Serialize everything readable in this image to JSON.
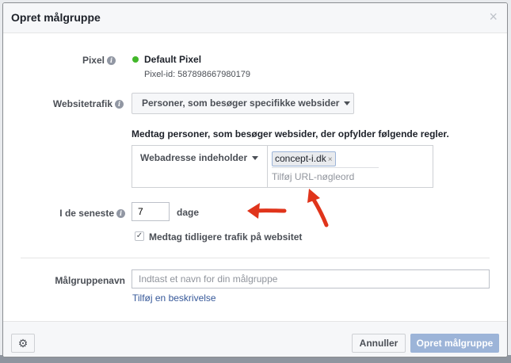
{
  "dialog": {
    "title": "Opret målgruppe",
    "close_glyph": "×"
  },
  "pixel": {
    "label": "Pixel",
    "name": "Default Pixel",
    "id_text": "Pixel-id: 587898667980179",
    "status_color": "#42b72a"
  },
  "traffic": {
    "label": "Websitetrafik",
    "selected": "Personer, som besøger specifikke websider"
  },
  "rules": {
    "title": "Medtag personer, som besøger websider, der opfylder følgende regler.",
    "condition": "Webadresse indeholder",
    "keyword_token": "concept-i.dk",
    "keyword_placeholder": "Tilføj URL-nøgleord"
  },
  "period": {
    "label": "I de seneste",
    "value": "7",
    "unit": "dage",
    "checkbox_checked": true,
    "checkbox_label": "Medtag tidligere trafik på websitet"
  },
  "audience_name": {
    "label": "Målgruppenavn",
    "placeholder": "Indtast et navn for din målgruppe",
    "add_description": "Tilføj en beskrivelse"
  },
  "footer": {
    "cancel_label": "Annuller",
    "create_label": "Opret målgruppe"
  },
  "icons": {
    "info": "i",
    "gear": "⚙",
    "check": "✓",
    "remove": "×"
  },
  "colors": {
    "primary_disabled": "#9cb4d8",
    "link": "#365899",
    "annotation_arrow": "#e0341b"
  }
}
